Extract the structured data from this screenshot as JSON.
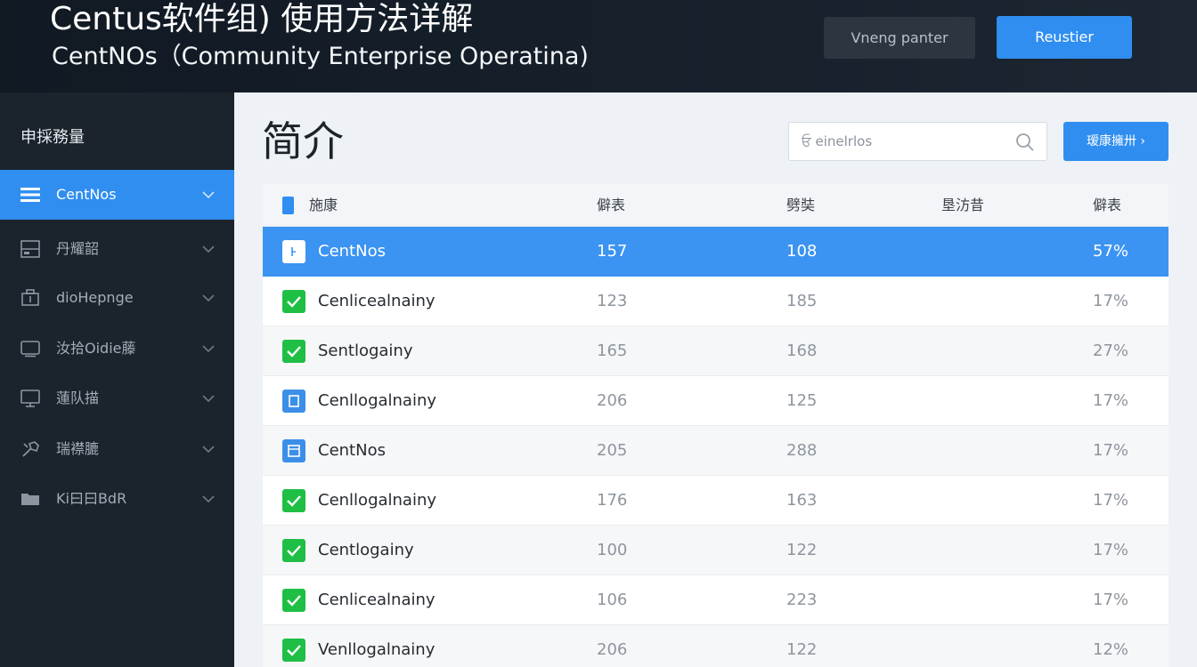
{
  "header": {
    "title": "Centus软件组) 使用方法详解",
    "subtitle": "CentNOs（Community Enterprise Operatina)",
    "btn_secondary": "Vneng panter",
    "btn_primary": "Reustier"
  },
  "sidebar": {
    "heading": "申採務量",
    "items": [
      {
        "label": "CentNos",
        "icon": "menu-icon"
      },
      {
        "label": "丹耀韶",
        "icon": "server-icon"
      },
      {
        "label": "dioHepnge",
        "icon": "package-icon"
      },
      {
        "label": "汝拾Oidie藤",
        "icon": "terminal-icon"
      },
      {
        "label": "蓮队描",
        "icon": "monitor-icon"
      },
      {
        "label": "瑞襟膔",
        "icon": "tools-icon"
      },
      {
        "label": "Ki曰曰BdR",
        "icon": "folder-icon"
      }
    ]
  },
  "main": {
    "title": "简介",
    "search_placeholder": "ਓ einelrlos",
    "next_button": "瑷康擁卅 ›"
  },
  "table": {
    "headers": [
      "施康",
      "僻表",
      "劈奘",
      "垦汸昔",
      "僻表"
    ],
    "rows": [
      {
        "name": "CentNos",
        "v1": "157",
        "v2": "108",
        "pct": "57%",
        "status": "selected"
      },
      {
        "name": "Cenlicealnainy",
        "v1": "123",
        "v2": "185",
        "pct": "17%",
        "status": "green"
      },
      {
        "name": "Sentlogainy",
        "v1": "165",
        "v2": "168",
        "pct": "27%",
        "status": "green"
      },
      {
        "name": "Cenllogalnainy",
        "v1": "206",
        "v2": "125",
        "pct": "17%",
        "status": "blue"
      },
      {
        "name": "CentNos",
        "v1": "205",
        "v2": "288",
        "pct": "17%",
        "status": "blue"
      },
      {
        "name": "Cenllogalnainy",
        "v1": "176",
        "v2": "163",
        "pct": "17%",
        "status": "green"
      },
      {
        "name": "Centlogainy",
        "v1": "100",
        "v2": "122",
        "pct": "17%",
        "status": "green"
      },
      {
        "name": "Cenlicealnainy",
        "v1": "106",
        "v2": "223",
        "pct": "17%",
        "status": "green"
      },
      {
        "name": "Venllogalnainy",
        "v1": "206",
        "v2": "122",
        "pct": "12%",
        "status": "green"
      }
    ]
  },
  "colors": {
    "accent": "#2f8ef0",
    "header_bg": "#131b25",
    "sidebar_bg": "#1b232c",
    "check_green": "#1fbf45"
  }
}
